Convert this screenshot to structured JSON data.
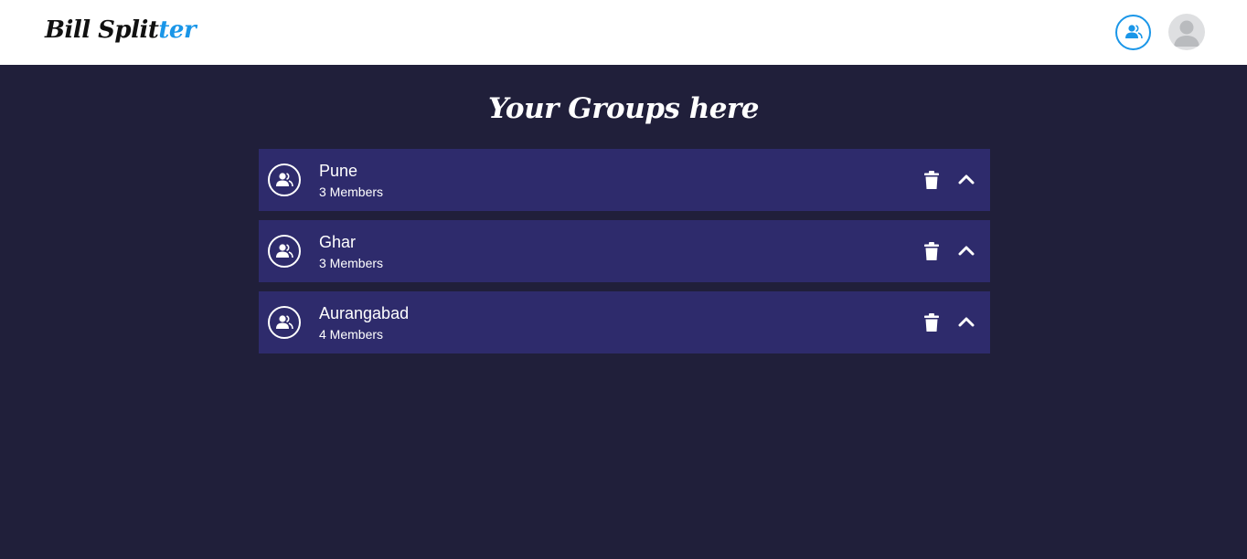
{
  "navbar": {
    "brand_main": "Bill Split",
    "brand_accent": "ter",
    "groups_icon": "groups-icon",
    "avatar_icon": "user-avatar-icon",
    "accent_color": "#1a96e8"
  },
  "main": {
    "title": "Your Groups here",
    "background_color": "#201f3a",
    "card_color": "#2e2b6c",
    "groups": [
      {
        "name": "Pune",
        "members": "3 Members"
      },
      {
        "name": "Ghar",
        "members": "3 Members"
      },
      {
        "name": "Aurangabad",
        "members": "4 Members"
      }
    ],
    "icons": {
      "group": "group-people-icon",
      "delete": "trash-icon",
      "toggle": "chevron-up-icon"
    }
  }
}
